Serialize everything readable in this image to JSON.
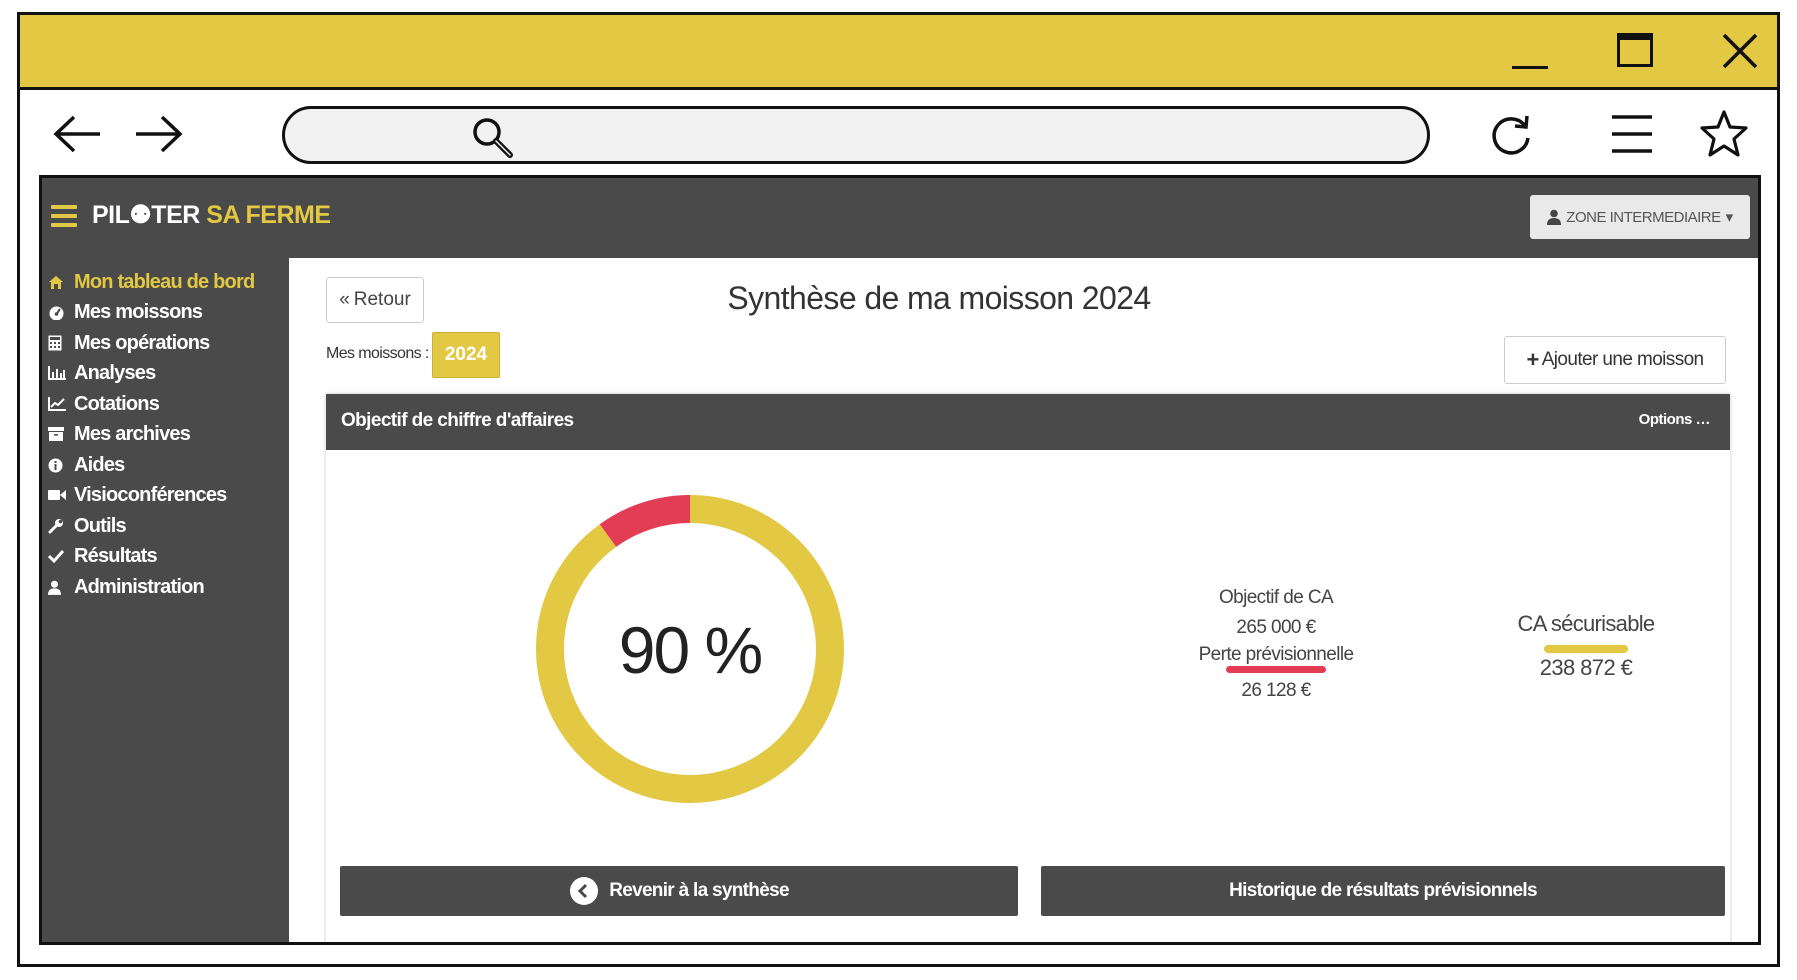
{
  "app": {
    "brand_part1": "PIL⚉TER",
    "brand_part2": "SA FERME",
    "zone_button": "ZONE INTERMEDIAIRE"
  },
  "sidebar": {
    "items": [
      {
        "label": "Mon tableau de bord",
        "icon": "home-icon",
        "active": true
      },
      {
        "label": "Mes moissons",
        "icon": "dashboard-icon"
      },
      {
        "label": "Mes opérations",
        "icon": "calculator-icon"
      },
      {
        "label": "Analyses",
        "icon": "bar-chart-icon"
      },
      {
        "label": "Cotations",
        "icon": "line-chart-icon"
      },
      {
        "label": "Mes archives",
        "icon": "archive-icon"
      },
      {
        "label": "Aides",
        "icon": "info-icon"
      },
      {
        "label": "Visioconférences",
        "icon": "video-camera-icon"
      },
      {
        "label": "Outils",
        "icon": "wrench-icon"
      },
      {
        "label": "Résultats",
        "icon": "check-icon"
      },
      {
        "label": "Administration",
        "icon": "user-icon"
      }
    ]
  },
  "page": {
    "back_label": "Retour",
    "title": "Synthèse de ma moisson 2024",
    "moissons_label": "Mes moissons :",
    "year": "2024",
    "add_label": "Ajouter une moisson"
  },
  "panel": {
    "title": "Objectif de chiffre d'affaires",
    "options": "Options …",
    "percent_text": "90 %",
    "objectif_label": "Objectif de CA",
    "objectif_value": "265 000 €",
    "perte_label": "Perte prévisionnelle",
    "perte_value": "26 128 €",
    "secure_label": "CA sécurisable",
    "secure_value": "238 872 €",
    "btn_back_synthese": "Revenir à la synthèse",
    "btn_history": "Historique de résultats prévisionnels"
  },
  "donut": {
    "secure_fraction": 0.9,
    "loss_fraction": 0.1,
    "secure_color": "#e2c843",
    "loss_color": "#e23d55"
  },
  "colors": {
    "accent_yellow": "#e2c843",
    "dark_gray": "#4a4a4a",
    "loss_red": "#e23d55"
  }
}
